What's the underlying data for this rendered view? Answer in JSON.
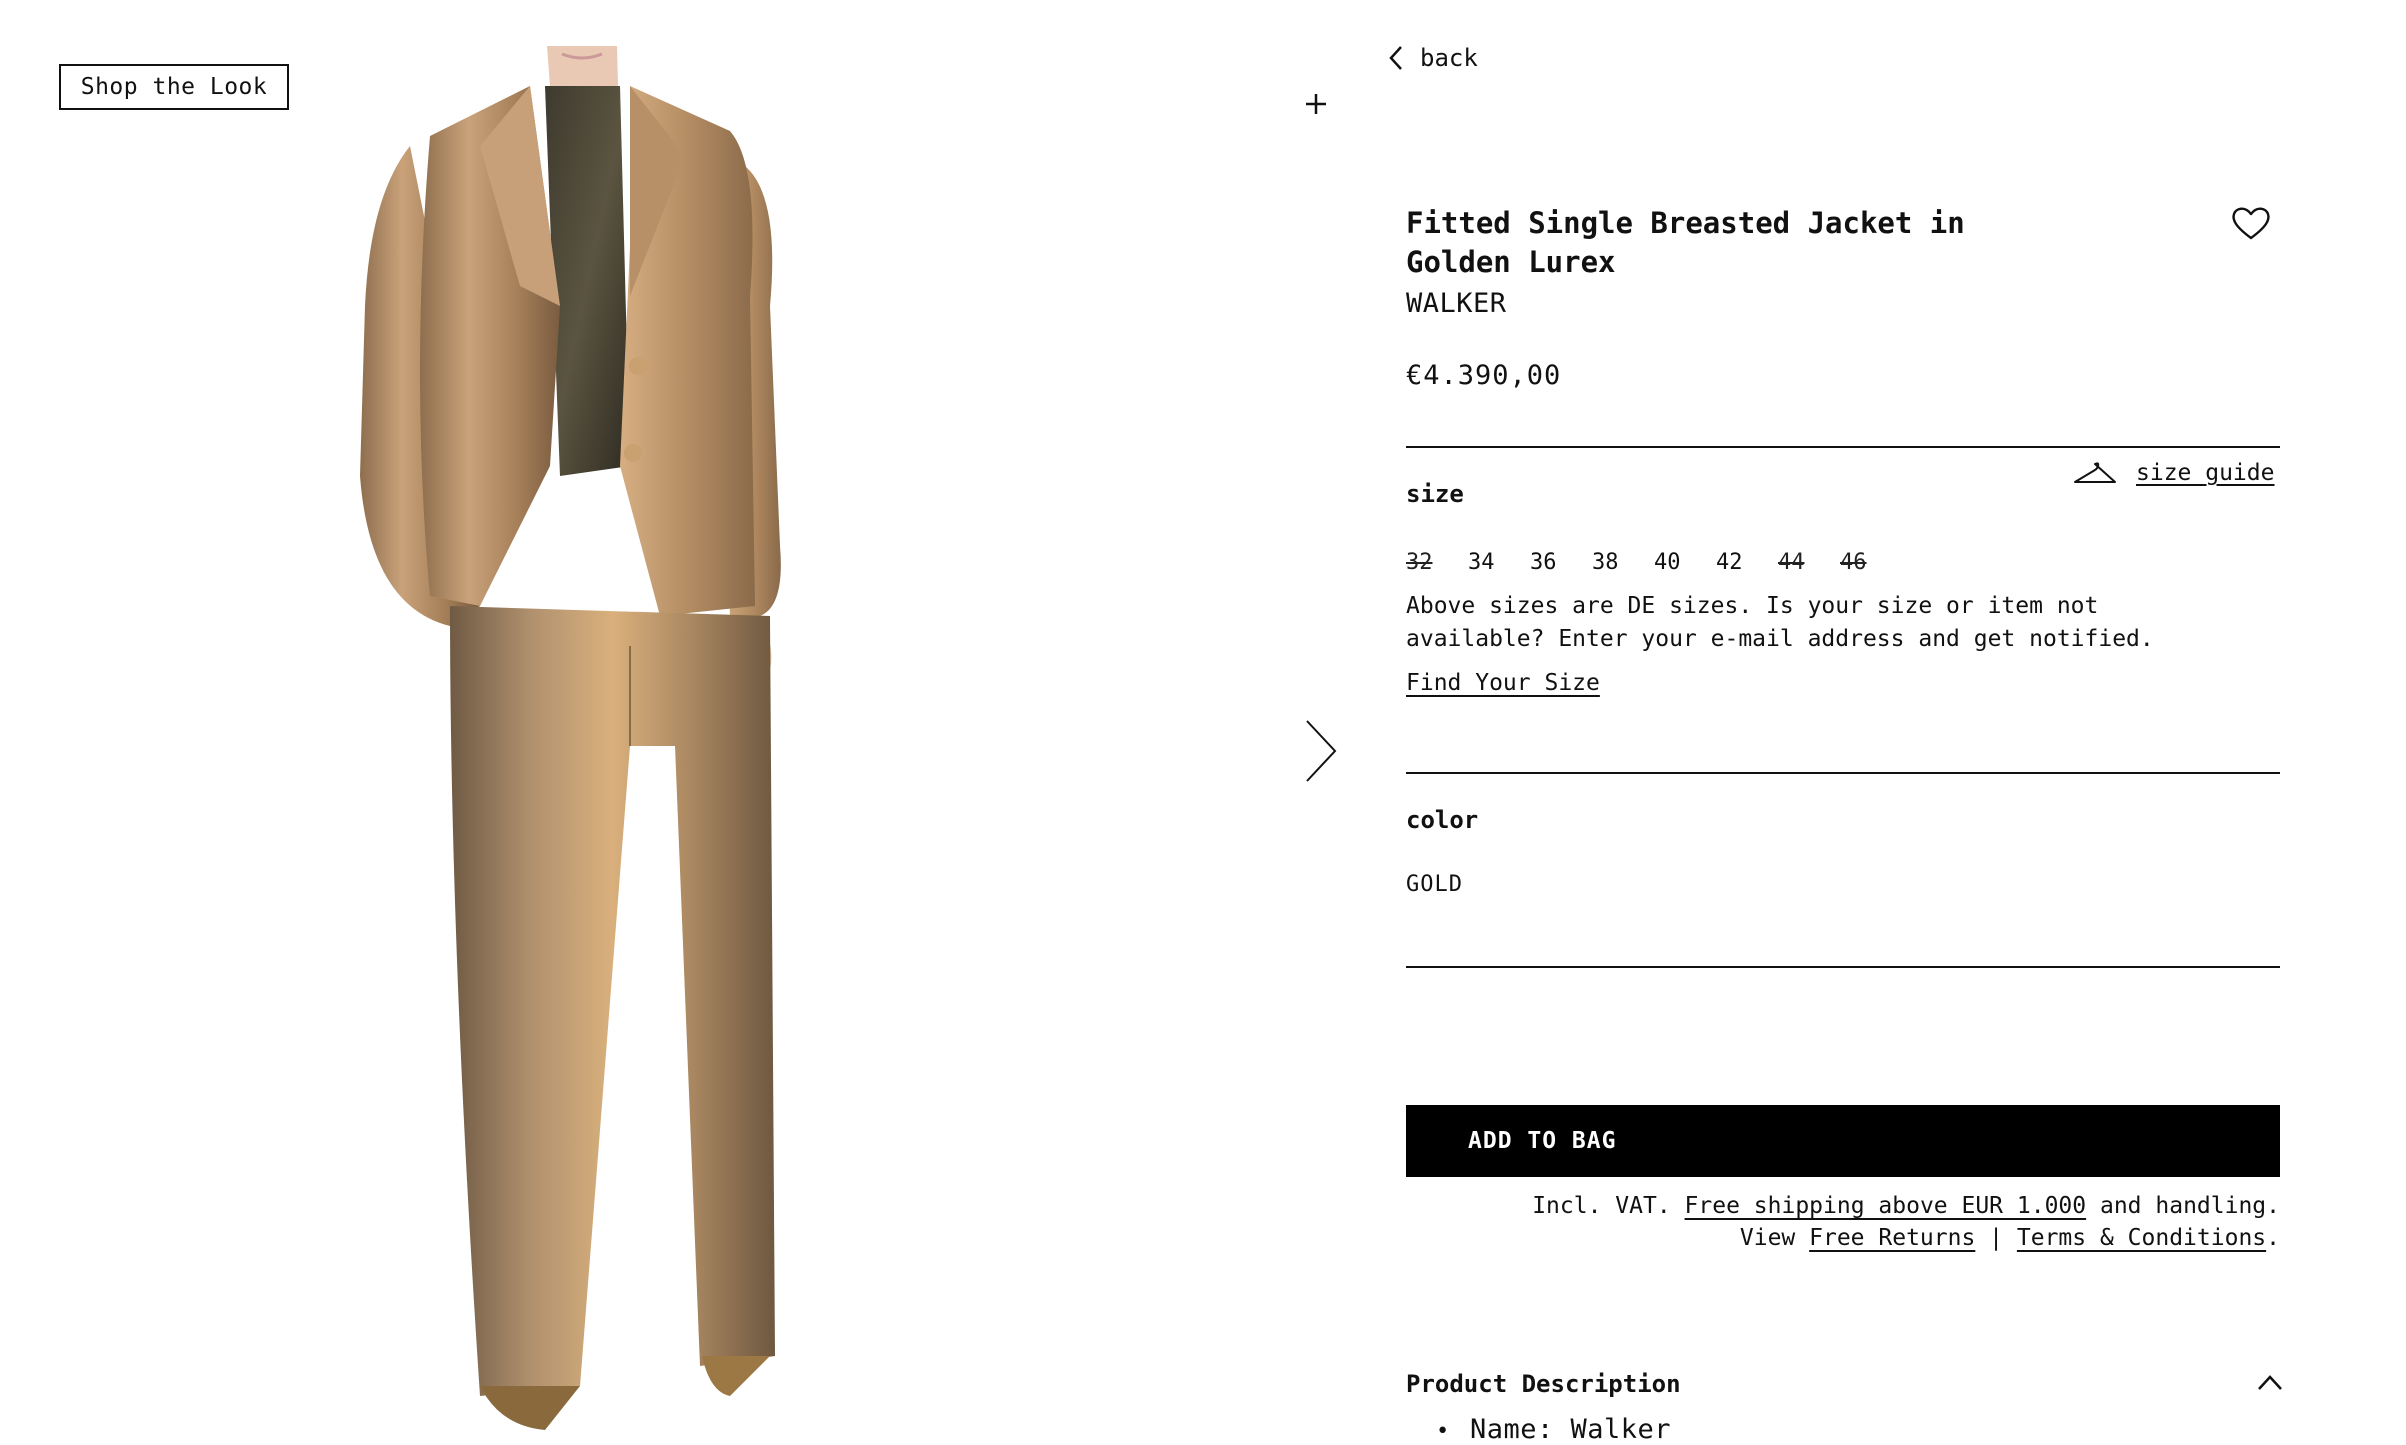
{
  "gallery": {
    "shop_the_look": "Shop the Look"
  },
  "nav": {
    "back_label": "back"
  },
  "product": {
    "title_line1": "Fitted Single Breasted Jacket in",
    "title_line2": "Golden Lurex",
    "brand": "WALKER",
    "price": "€4.390,00"
  },
  "size": {
    "label": "size",
    "guide_label": "size guide",
    "options": [
      {
        "label": "32",
        "available": false
      },
      {
        "label": "34",
        "available": true
      },
      {
        "label": "36",
        "available": true
      },
      {
        "label": "38",
        "available": true
      },
      {
        "label": "40",
        "available": true
      },
      {
        "label": "42",
        "available": true
      },
      {
        "label": "44",
        "available": false
      },
      {
        "label": "46",
        "available": false
      }
    ],
    "note_line1": "Above sizes are DE sizes. Is your size or item not",
    "note_line2": "available? Enter your e-mail address and get notified.",
    "find_your_size": "Find Your Size"
  },
  "color": {
    "label": "color",
    "value": "GOLD"
  },
  "cart": {
    "add_to_bag": "ADD TO BAG"
  },
  "legal": {
    "incl_vat": "Incl. VAT.",
    "free_shipping": "Free shipping above EUR 1.000",
    "handling": "and handling.",
    "view": "View",
    "free_returns": "Free Returns",
    "separator": "|",
    "terms": "Terms & Conditions",
    "period": "."
  },
  "description": {
    "title": "Product Description",
    "items": [
      "Name: Walker"
    ]
  },
  "icons": {
    "back": "chevron-left-icon",
    "zoom": "plus-icon",
    "next": "chevron-right-icon",
    "wishlist": "heart-icon",
    "size_guide": "hanger-icon",
    "collapse": "chevron-up-icon"
  },
  "colors": {
    "text": "#111111",
    "button_bg": "#000000",
    "button_text": "#ffffff",
    "fabric_gold": "#b08a5e"
  }
}
